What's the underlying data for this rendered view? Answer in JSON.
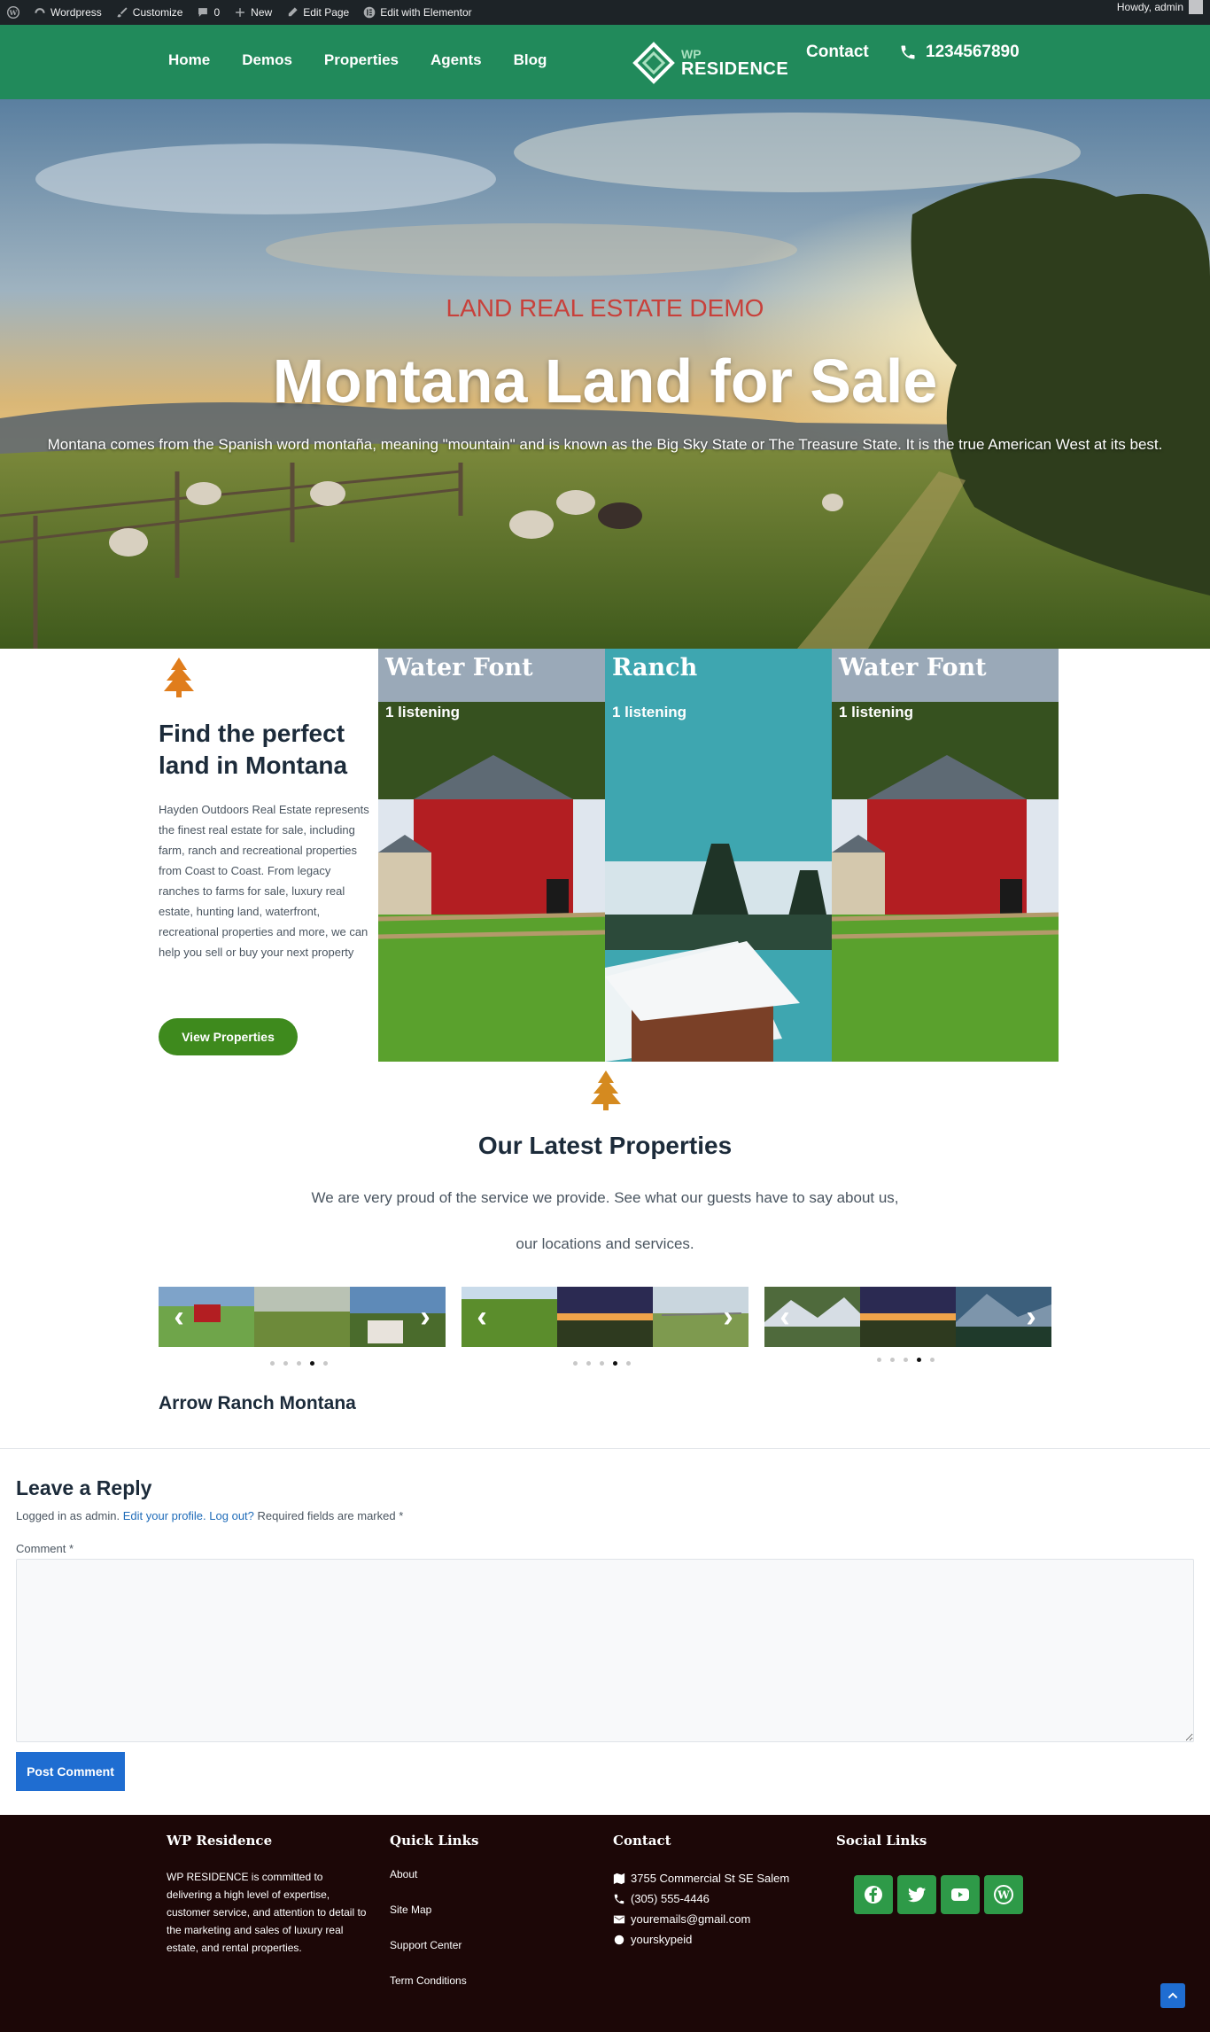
{
  "adminbar": {
    "site_name": "Wordpress",
    "customize": "Customize",
    "comments_count": "0",
    "new": "New",
    "edit_page": "Edit Page",
    "edit_elementor": "Edit with Elementor",
    "howdy": "Howdy, admin"
  },
  "header": {
    "nav": [
      "Home",
      "Demos",
      "Properties",
      "Agents",
      "Blog"
    ],
    "logo_wp": "WP",
    "logo_residence": "RESIDENCE",
    "contact": "Contact",
    "phone": "1234567890",
    "brand_color": "#218a5b"
  },
  "hero": {
    "kicker": "LAND REAL ESTATE DEMO",
    "title": "Montana Land for Sale",
    "text": "Montana comes from the Spanish word montaña, meaning \"mountain\" and is known as the Big Sky State or The Treasure State. It is the true American West at its best."
  },
  "find": {
    "title": "Find the perfect land in Montana",
    "text": "Hayden Outdoors Real Estate represents the finest real estate for sale, including farm, ranch and recreational properties from Coast to Coast. From legacy ranches to farms for sale, luxury real estate, hunting land, waterfront, recreational properties and more, we can help you sell or buy your next property",
    "button": "View Properties"
  },
  "cards": [
    {
      "title": "Water Font",
      "sub": "1 listening"
    },
    {
      "title": "Ranch",
      "sub": "1 listening"
    },
    {
      "title": "Water Font",
      "sub": "1 listening"
    }
  ],
  "latest": {
    "title": "Our Latest Properties",
    "subtitle": "We are very proud of the service we provide. See what our guests have to say about us, our locations and services.",
    "property_name": "Arrow Ranch Montana"
  },
  "sliders": [
    {
      "active_dot": 4,
      "dot_count": 5
    },
    {
      "active_dot": 4,
      "dot_count": 5
    },
    {
      "active_dot": 4,
      "dot_count": 5
    }
  ],
  "comments": {
    "title": "Leave a Reply",
    "logged_prefix": "Logged in as admin.",
    "edit_profile": "Edit your profile.",
    "logout": "Log out?",
    "required": "Required fields are marked *",
    "comment_label": "Comment *",
    "post_button": "Post Comment"
  },
  "footer": {
    "col1_title": "WP Residence",
    "col1_text": "WP RESIDENCE is committed to delivering a high level of expertise, customer service, and attention to detail to the marketing and sales of luxury real estate, and rental properties.",
    "col2_title": "Quick Links",
    "links": [
      "About",
      "Site Map",
      "Support Center",
      "Term Conditions"
    ],
    "col3_title": "Contact",
    "address": "3755 Commercial St SE Salem",
    "phone": "(305) 555-4446",
    "email": "youremails@gmail.com",
    "skype": "yourskypeid",
    "col4_title": "Social Links",
    "socials": [
      "facebook-icon",
      "twitter-icon",
      "youtube-icon",
      "wordpress-icon"
    ]
  }
}
